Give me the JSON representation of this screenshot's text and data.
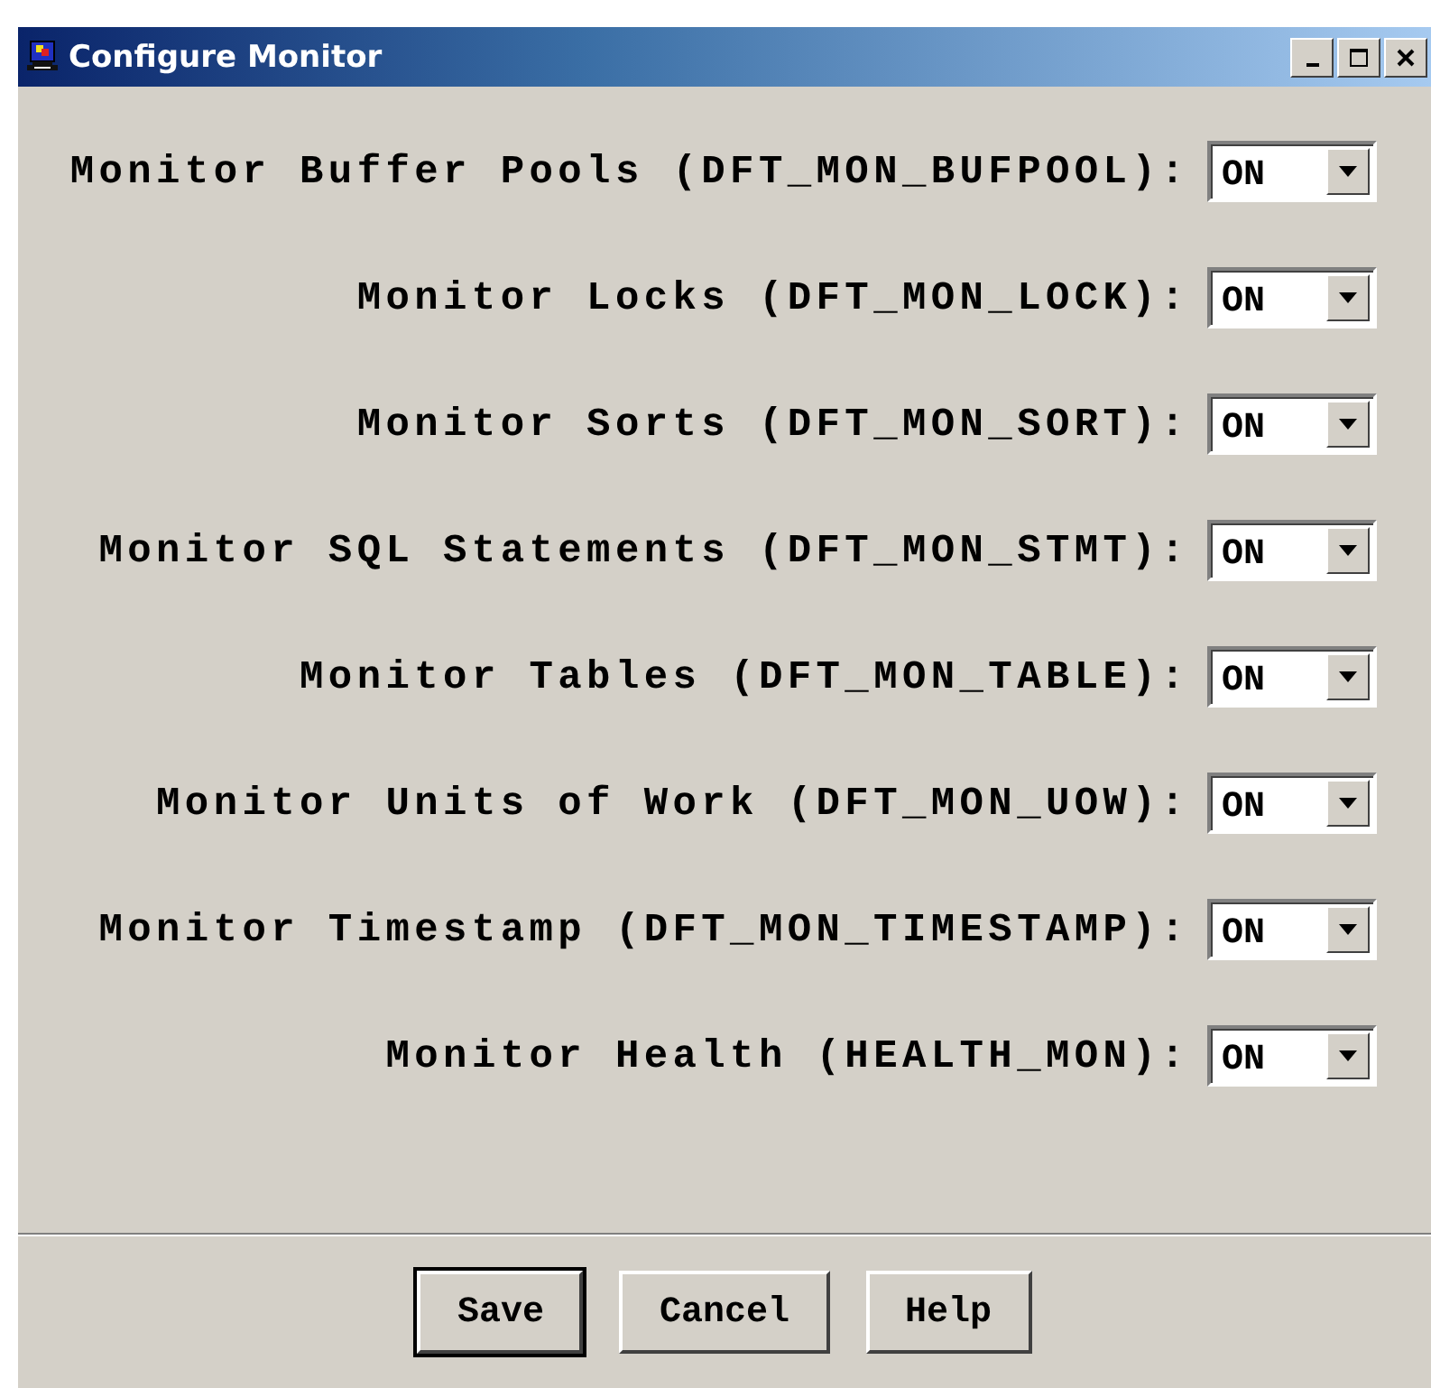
{
  "window": {
    "title": "Configure Monitor"
  },
  "settings": [
    {
      "label": "Monitor Buffer Pools (DFT_MON_BUFPOOL):",
      "value": "ON"
    },
    {
      "label": "Monitor Locks (DFT_MON_LOCK):",
      "value": "ON"
    },
    {
      "label": "Monitor Sorts (DFT_MON_SORT):",
      "value": "ON"
    },
    {
      "label": "Monitor SQL Statements (DFT_MON_STMT):",
      "value": "ON"
    },
    {
      "label": "Monitor Tables (DFT_MON_TABLE):",
      "value": "ON"
    },
    {
      "label": "Monitor Units of Work (DFT_MON_UOW):",
      "value": "ON"
    },
    {
      "label": "Monitor Timestamp (DFT_MON_TIMESTAMP):",
      "value": "ON"
    },
    {
      "label": "Monitor Health (HEALTH_MON):",
      "value": "ON"
    }
  ],
  "buttons": [
    {
      "label": "Save",
      "default": true
    },
    {
      "label": "Cancel",
      "default": false
    },
    {
      "label": "Help",
      "default": false
    }
  ]
}
